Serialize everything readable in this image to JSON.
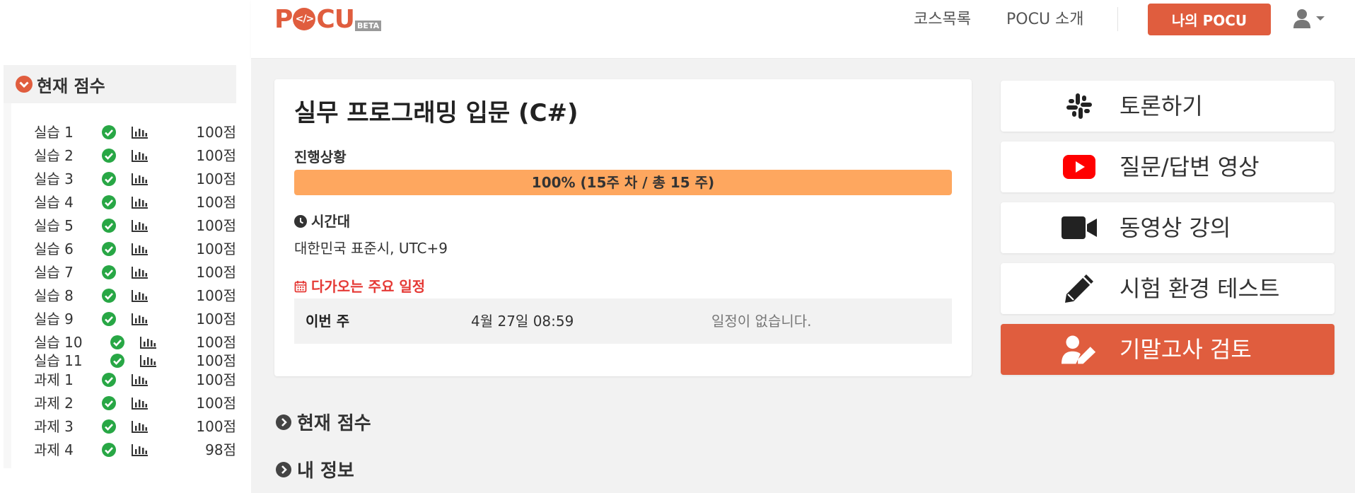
{
  "header": {
    "logo_text": "POCU",
    "logo_badge": "BETA",
    "nav": [
      "코스목록",
      "POCU 소개"
    ],
    "my_pocu_button": "나의 POCU",
    "user_icon": "user-icon",
    "caret_icon": "caret-down-icon"
  },
  "score_panel": {
    "title": "현재 점수",
    "rows": [
      {
        "label": "실습 1",
        "score": "100점"
      },
      {
        "label": "실습 2",
        "score": "100점"
      },
      {
        "label": "실습 3",
        "score": "100점"
      },
      {
        "label": "실습 4",
        "score": "100점"
      },
      {
        "label": "실습 5",
        "score": "100점"
      },
      {
        "label": "실습 6",
        "score": "100점"
      },
      {
        "label": "실습 7",
        "score": "100점"
      },
      {
        "label": "실습 8",
        "score": "100점"
      },
      {
        "label": "실습 9",
        "score": "100점"
      },
      {
        "label": "실습 10",
        "score": "100점"
      },
      {
        "label": "실습 11",
        "score": "100점"
      },
      {
        "label": "과제 1",
        "score": "100점"
      },
      {
        "label": "과제 2",
        "score": "100점"
      },
      {
        "label": "과제 3",
        "score": "100점"
      },
      {
        "label": "과제 4",
        "score": "98점"
      }
    ]
  },
  "course": {
    "title": "실무 프로그래밍 입문 (C#)",
    "progress_label": "진행상황",
    "progress_percent": 100,
    "progress_text": "100% (15주 차 / 총 15 주)",
    "timezone_label": "시간대",
    "timezone_value": "대한민국 표준시, UTC+9",
    "schedule_label": "다가오는 주요 일정",
    "schedule": {
      "week": "이번 주",
      "date": "4월 27일 08:59",
      "message": "일정이 없습니다."
    }
  },
  "sections": [
    {
      "label": "현재 점수"
    },
    {
      "label": "내 정보"
    }
  ],
  "actions": [
    {
      "label": "토론하기",
      "icon": "slack-icon"
    },
    {
      "label": "질문/답변 영상",
      "icon": "youtube-icon"
    },
    {
      "label": "동영상 강의",
      "icon": "video-camera-icon"
    },
    {
      "label": "시험 환경 테스트",
      "icon": "pencil-icon"
    },
    {
      "label": "기말고사 검토",
      "icon": "user-edit-icon"
    }
  ],
  "colors": {
    "brand": "#e05d3e",
    "progress_fill": "#fea75f",
    "success": "#28a745",
    "schedule_red": "#e53935",
    "youtube_red": "#ff0000"
  }
}
